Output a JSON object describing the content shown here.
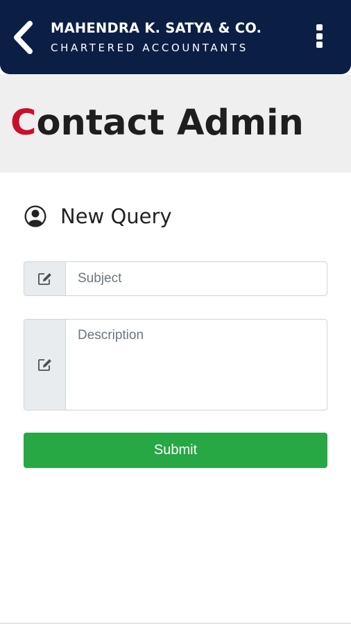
{
  "header": {
    "firm_name": "MAHENDRA K. SATYA & CO.",
    "firm_tagline": "CHARTERED ACCOUNTANTS",
    "back_icon": "chevron-left-icon",
    "menu_icon": "more-vertical-icon",
    "background_color": "#0b1f45"
  },
  "page": {
    "title_first_letter": "C",
    "title_rest": "ontact Admin",
    "accent_color": "#c8102e"
  },
  "form": {
    "heading_icon": "user-circle-icon",
    "heading": "New Query",
    "subject": {
      "icon": "edit-icon",
      "placeholder": "Subject",
      "value": ""
    },
    "description": {
      "icon": "edit-icon",
      "placeholder": "Description",
      "value": ""
    },
    "submit_label": "Submit",
    "submit_color": "#28a745"
  }
}
